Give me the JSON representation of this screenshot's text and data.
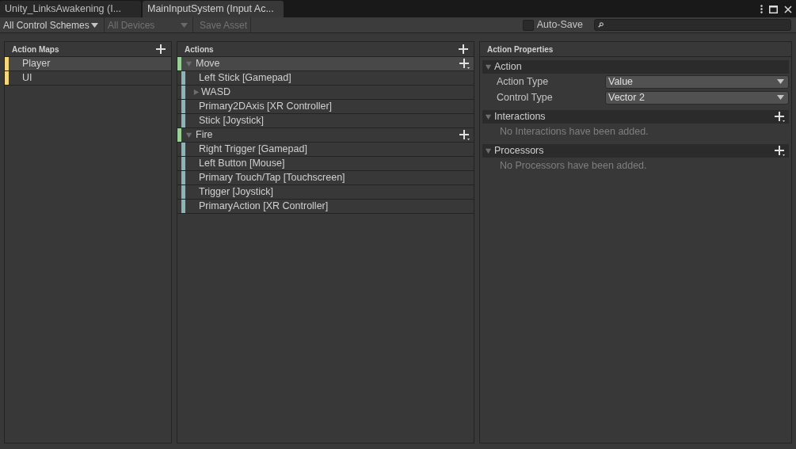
{
  "tabs": [
    {
      "label": "Unity_LinksAwakening (I...",
      "selected": false
    },
    {
      "label": "MainInputSystem (Input Ac...",
      "selected": true
    }
  ],
  "toolbar": {
    "control_schemes": {
      "value": "All Control Schemes",
      "disabled": false
    },
    "devices": {
      "value": "All Devices",
      "disabled": true
    },
    "save_asset": {
      "label": "Save Asset",
      "disabled": true
    },
    "auto_save": {
      "label": "Auto-Save",
      "checked": false
    }
  },
  "action_maps": {
    "title": "Action Maps",
    "items": [
      {
        "label": "Player",
        "selected": true
      },
      {
        "label": "UI",
        "selected": false
      }
    ]
  },
  "actions": {
    "title": "Actions",
    "items": [
      {
        "label": "Move",
        "selected": true,
        "expanded": true,
        "children": [
          {
            "label": "Left Stick [Gamepad]",
            "kind": "binding"
          },
          {
            "label": "WASD",
            "kind": "composite",
            "expanded": false
          },
          {
            "label": "Primary2DAxis [XR Controller]",
            "kind": "binding"
          },
          {
            "label": "Stick [Joystick]",
            "kind": "binding"
          }
        ]
      },
      {
        "label": "Fire",
        "selected": false,
        "expanded": true,
        "children": [
          {
            "label": "Right Trigger [Gamepad]",
            "kind": "binding"
          },
          {
            "label": "Left Button [Mouse]",
            "kind": "binding"
          },
          {
            "label": "Primary Touch/Tap [Touchscreen]",
            "kind": "binding"
          },
          {
            "label": "Trigger [Joystick]",
            "kind": "binding"
          },
          {
            "label": "PrimaryAction [XR Controller]",
            "kind": "binding"
          }
        ]
      }
    ]
  },
  "properties": {
    "title": "Action Properties",
    "sections": [
      {
        "title": "Action",
        "kind": "fields",
        "expanded": true,
        "fields": [
          {
            "label": "Action Type",
            "value": "Value"
          },
          {
            "label": "Control Type",
            "value": "Vector 2"
          }
        ]
      },
      {
        "title": "Interactions",
        "kind": "list",
        "expanded": true,
        "empty_text": "No Interactions have been added."
      },
      {
        "title": "Processors",
        "kind": "list",
        "expanded": true,
        "empty_text": "No Processors have been added."
      }
    ]
  }
}
